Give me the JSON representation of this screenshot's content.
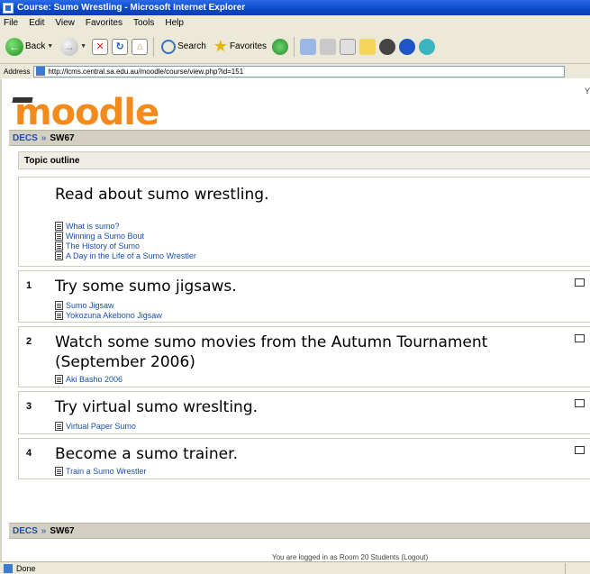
{
  "window": {
    "title": "Course: Sumo Wrestling - Microsoft Internet Explorer"
  },
  "menu": [
    "File",
    "Edit",
    "View",
    "Favorites",
    "Tools",
    "Help"
  ],
  "toolbar": {
    "back_label": "Back",
    "search_label": "Search",
    "favorites_label": "Favorites"
  },
  "address": {
    "label": "Address",
    "url": "http://lcms.central.sa.edu.au/moodle/course/view.php?id=151"
  },
  "page": {
    "logo_text": "moodle",
    "topright_text": "Y",
    "breadcrumb": {
      "root": "DECS",
      "separator": "»",
      "current": "SW67"
    },
    "outline_title": "Topic outline",
    "sections": [
      {
        "number": "",
        "summary": "Read about sumo wrestling.",
        "resources": [
          "What is sumo?",
          "Winning a Sumo Bout",
          "The History of Sumo",
          "A Day in the Life of a Sumo Wrestler"
        ]
      },
      {
        "number": "1",
        "summary": "Try some sumo jigsaws.",
        "resources": [
          "Sumo Jigsaw",
          "Yokozuna Akebono Jigsaw"
        ]
      },
      {
        "number": "2",
        "summary": "Watch some sumo movies from the Autumn Tournament (September 2006)",
        "resources": [
          "Aki Basho 2006"
        ]
      },
      {
        "number": "3",
        "summary": "Try virtual sumo wreslting.",
        "resources": [
          "Virtual Paper Sumo"
        ]
      },
      {
        "number": "4",
        "summary": "Become a sumo trainer.",
        "resources": [
          "Train a Sumo Wrestler"
        ]
      }
    ],
    "footer_breadcrumb": {
      "root": "DECS",
      "separator": "»",
      "current": "SW67"
    },
    "loggedin_text": "You are logged in as Room 20 Students (Logout)"
  },
  "status": {
    "text": "Done"
  }
}
